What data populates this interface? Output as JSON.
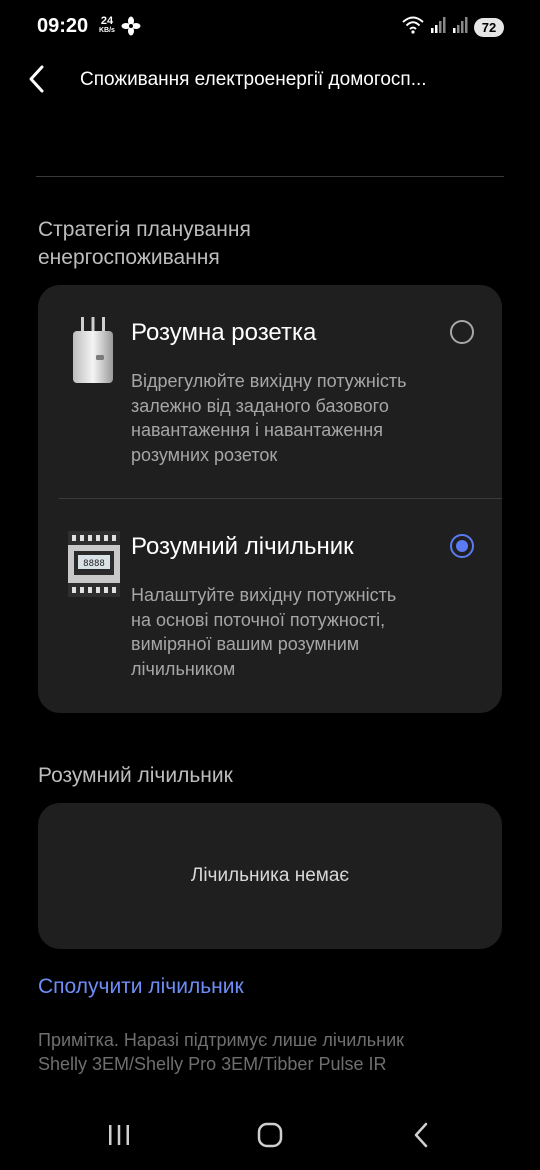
{
  "status_bar": {
    "time": "09:20",
    "speed_value": "24",
    "speed_unit": "KB/s",
    "battery": "72"
  },
  "header": {
    "title": "Споживання електроенергії домогосп..."
  },
  "strategy": {
    "label_line1": "Стратегія планування",
    "label_line2": "енергоспоживання",
    "options": [
      {
        "title": "Розумна розетка",
        "desc_lines": [
          "Відрегулюйте вихідну потужність",
          "залежно від заданого базового",
          "навантаження і навантаження",
          "розумних розеток"
        ],
        "selected": false
      },
      {
        "title": "Розумний лічильник",
        "desc_lines": [
          "Налаштуйте вихідну потужність",
          "на основі поточної потужності,",
          "виміряної вашим розумним",
          "лічильником"
        ],
        "selected": true
      }
    ]
  },
  "meter": {
    "label": "Розумний лічильник",
    "empty_text": "Лічильника немає",
    "meter_display": "8888"
  },
  "connect_link": "Сполучити лічильник",
  "note_line1": "Примітка. Наразі підтримує лише лічильник",
  "note_line2": "Shelly 3EM/Shelly Pro 3EM/Tibber Pulse IR",
  "colors": {
    "accent": "#5b7bf5",
    "link": "#6e8ef7",
    "card": "#1f1f1f"
  }
}
